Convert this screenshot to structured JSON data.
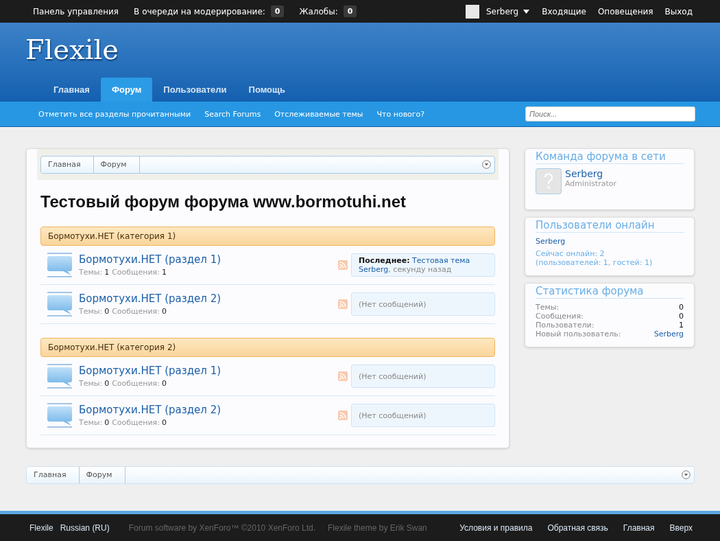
{
  "top_bar": {
    "left": [
      {
        "label": "Панель управления"
      },
      {
        "label": "В очереди на модерирование:",
        "count": "0"
      },
      {
        "label": "Жалобы:",
        "count": "0"
      }
    ],
    "user": {
      "name": "Serberg"
    },
    "right": [
      "Входящие",
      "Оповещения",
      "Выход"
    ]
  },
  "header": {
    "logo": "Flexile",
    "tabs": [
      {
        "label": "Главная",
        "selected": false
      },
      {
        "label": "Форум",
        "selected": true
      },
      {
        "label": "Пользователи",
        "selected": false
      },
      {
        "label": "Помощь",
        "selected": false
      }
    ],
    "subnav": [
      "Отметить все разделы прочитанными",
      "Search Forums",
      "Отслеживаемые темы",
      "Что нового?"
    ],
    "search": {
      "placeholder": "Поиск..."
    }
  },
  "breadcrumb_top": [
    "Главная",
    "Форум"
  ],
  "page_title": "Тестовый форум форума www.bormotuhi.net",
  "categories": [
    {
      "title": "Бормотухи.НЕТ (категория 1)",
      "forums": [
        {
          "title": "Бормотухи.НЕТ (раздел 1)",
          "stats": [
            {
              "label": "Темы:",
              "value": "1"
            },
            {
              "label": "Сообщения:",
              "value": "1"
            }
          ],
          "last_post": {
            "kind": "post",
            "label": "Последнее:",
            "title": "Тестовая тема",
            "author": "Serberg",
            "time": ", секунду назад"
          }
        },
        {
          "title": "Бормотухи.НЕТ (раздел 2)",
          "stats": [
            {
              "label": "Темы:",
              "value": "0"
            },
            {
              "label": "Сообщения:",
              "value": "0"
            }
          ],
          "last_post": {
            "kind": "empty",
            "text": "(Нет сообщений)"
          }
        }
      ]
    },
    {
      "title": "Бормотухи.НЕТ (категория 2)",
      "forums": [
        {
          "title": "Бормотухи.НЕТ (раздел 1)",
          "stats": [
            {
              "label": "Темы:",
              "value": "0"
            },
            {
              "label": "Сообщения:",
              "value": "0"
            }
          ],
          "last_post": {
            "kind": "empty",
            "text": "(Нет сообщений)"
          }
        },
        {
          "title": "Бормотухи.НЕТ (раздел 2)",
          "stats": [
            {
              "label": "Темы:",
              "value": "0"
            },
            {
              "label": "Сообщения:",
              "value": "0"
            }
          ],
          "last_post": {
            "kind": "empty",
            "text": "(Нет сообщений)"
          }
        }
      ]
    }
  ],
  "sidebar": {
    "staff": {
      "title": "Команда форума в сети",
      "members": [
        {
          "name": "Serberg",
          "role": "Administrator"
        }
      ]
    },
    "online": {
      "title": "Пользователи онлайн",
      "users": [
        "Serberg"
      ],
      "summary": [
        "Сейчас онлайн: 2",
        "(пользователей: 1, гостей: 1)"
      ]
    },
    "stats": {
      "title": "Статистика форума",
      "rows": [
        {
          "label": "Темы:",
          "value": "0",
          "kind": "number"
        },
        {
          "label": "Сообщения:",
          "value": "0",
          "kind": "number"
        },
        {
          "label": "Пользователи:",
          "value": "1",
          "kind": "number"
        },
        {
          "label": "Новый пользователь:",
          "value": "Serberg",
          "kind": "link"
        }
      ]
    }
  },
  "breadcrumb_bottom": [
    "Главная",
    "Форум"
  ],
  "footer": {
    "left": [
      "Flexile",
      "Russian (RU)"
    ],
    "credits": [
      "Forum software by XenForo™ ©2010 XenForo Ltd.",
      "Flexile theme by Erik Swan"
    ],
    "right": [
      "Условия и правила",
      "Обратная связь",
      "Главная",
      "Вверх"
    ]
  }
}
